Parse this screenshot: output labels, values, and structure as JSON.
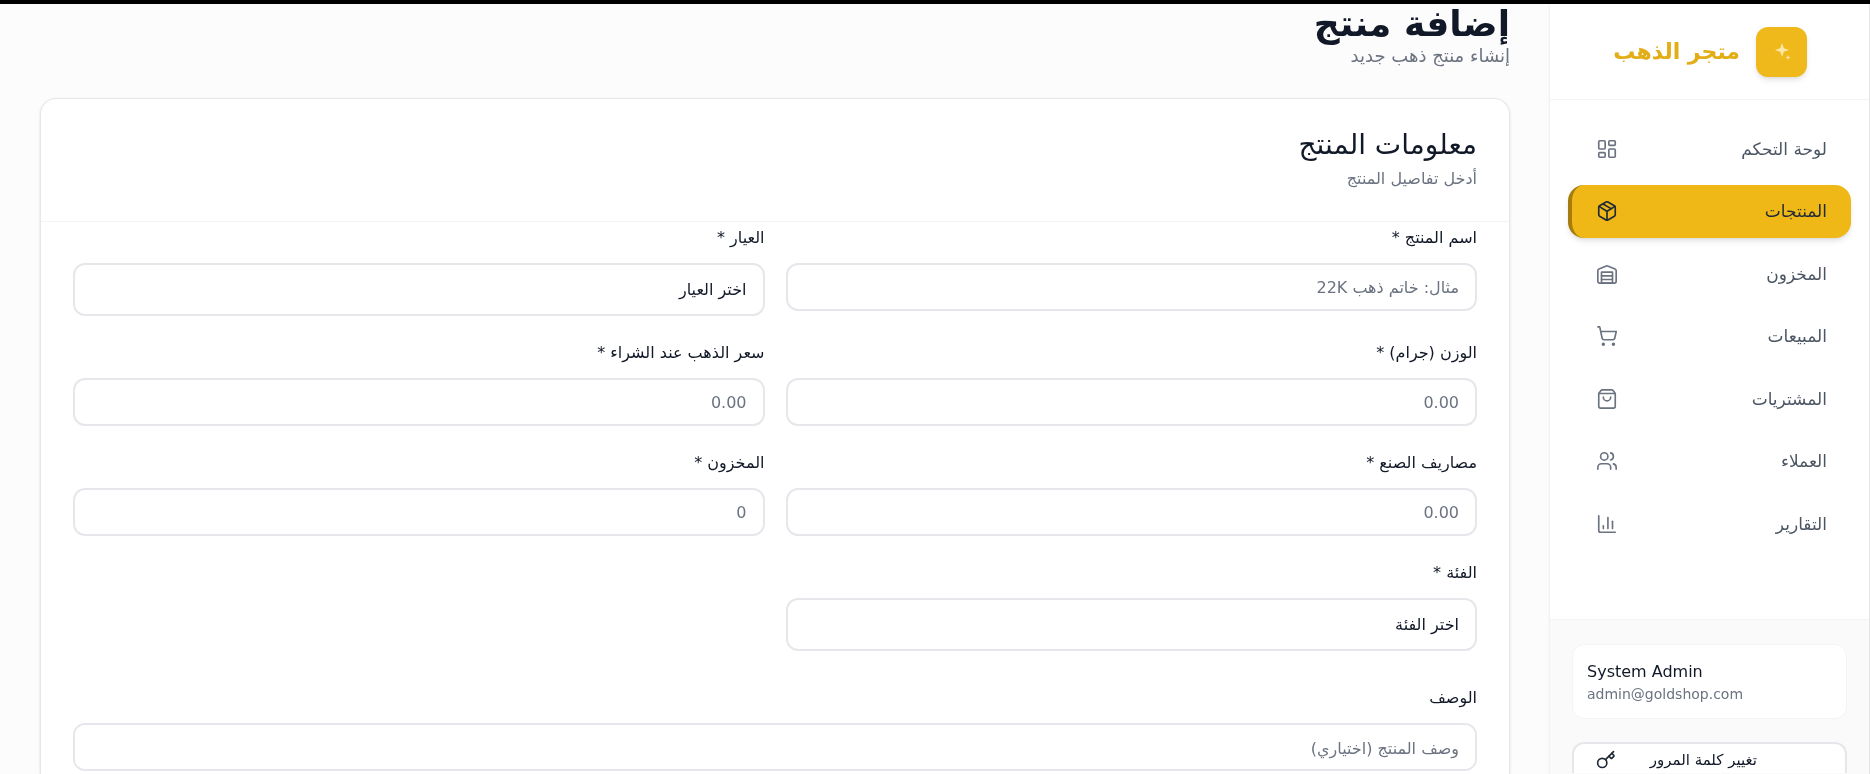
{
  "sidebar": {
    "brand": "متجر الذهب",
    "items": [
      {
        "label": "لوحة التحكم",
        "selected": false
      },
      {
        "label": "المنتجات",
        "selected": true
      },
      {
        "label": "المخزون",
        "selected": false
      },
      {
        "label": "المبيعات",
        "selected": false
      },
      {
        "label": "المشتريات",
        "selected": false
      },
      {
        "label": "العملاء",
        "selected": false
      },
      {
        "label": "التقارير",
        "selected": false
      }
    ],
    "user": {
      "name": "System Admin",
      "email": "admin@goldshop.com"
    },
    "change_password_button": "تغيير كلمة المرور"
  },
  "page_header": {
    "title": "إضافة منتج",
    "subtitle": "إنشاء منتج ذهب جديد"
  },
  "form_card": {
    "title": "معلومات المنتج",
    "subtitle": "أدخل تفاصيل المنتج",
    "fields": [
      {
        "kind": "input",
        "label": "اسم المنتج *",
        "placeholder": "مثال: خاتم ذهب 22K"
      },
      {
        "kind": "select",
        "label": "العيار *",
        "value": "اختر العيار"
      },
      {
        "kind": "input",
        "label": "الوزن (جرام) *",
        "placeholder": "0.00"
      },
      {
        "kind": "input",
        "label": "سعر الذهب عند الشراء *",
        "placeholder": "0.00"
      },
      {
        "kind": "input",
        "label": "مصاريف الصنع *",
        "placeholder": "0.00"
      },
      {
        "kind": "input",
        "label": "المخزون *",
        "placeholder": "0"
      },
      {
        "kind": "select",
        "label": "الفئة *",
        "value": "اختر الفئة"
      },
      {
        "kind": "textarea",
        "label": "الوصف",
        "placeholder": "وصف المنتج (اختياري)"
      }
    ]
  }
}
